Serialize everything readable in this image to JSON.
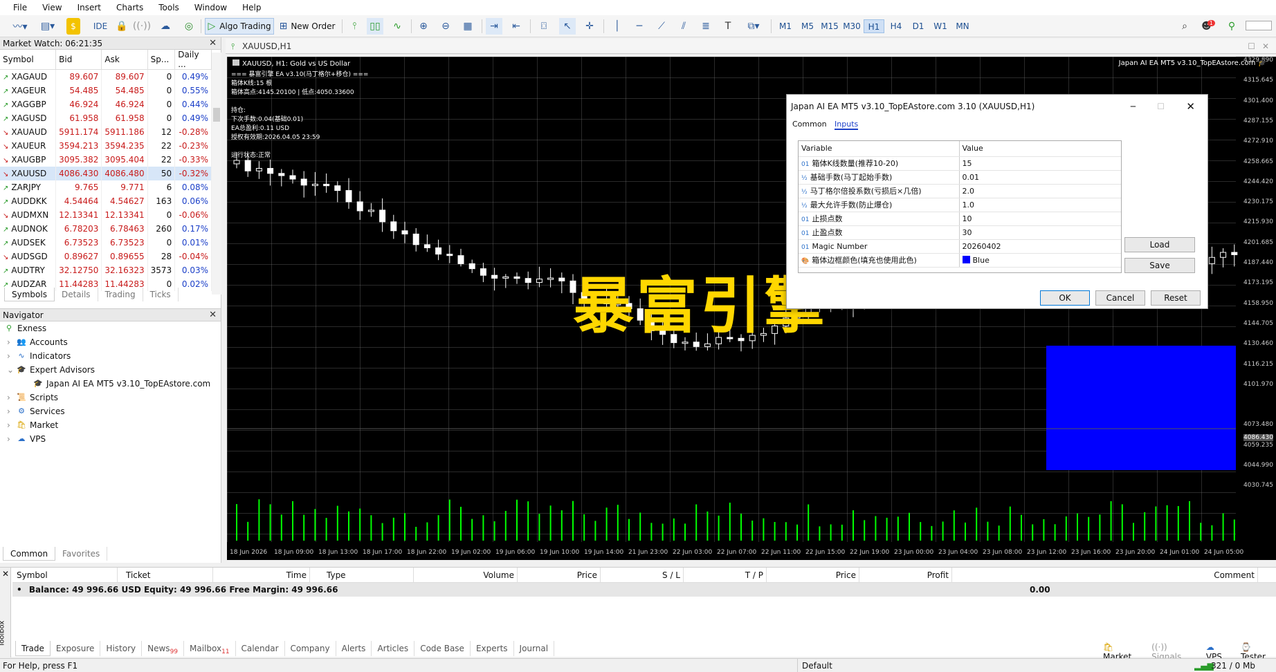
{
  "menu": [
    "File",
    "View",
    "Insert",
    "Charts",
    "Tools",
    "Window",
    "Help"
  ],
  "toolbar": {
    "ide": "IDE",
    "algo_trading": "Algo Trading",
    "new_order": "New Order",
    "timeframes": [
      "M1",
      "M5",
      "M15",
      "M30",
      "H1",
      "H4",
      "D1",
      "W1",
      "MN"
    ],
    "active_tf": "H1"
  },
  "market_watch": {
    "title": "Market Watch: 06:21:35",
    "headers": [
      "Symbol",
      "Bid",
      "Ask",
      "Sp...",
      "Daily ..."
    ],
    "rows": [
      [
        "XAGAUD",
        "89.607",
        "89.607",
        "0",
        "0.49%"
      ],
      [
        "XAGEUR",
        "54.485",
        "54.485",
        "0",
        "0.55%"
      ],
      [
        "XAGGBP",
        "46.924",
        "46.924",
        "0",
        "0.44%"
      ],
      [
        "XAGUSD",
        "61.958",
        "61.958",
        "0",
        "0.49%"
      ],
      [
        "XAUAUD",
        "5911.174",
        "5911.186",
        "12",
        "-0.28%"
      ],
      [
        "XAUEUR",
        "3594.213",
        "3594.235",
        "22",
        "-0.23%"
      ],
      [
        "XAUGBP",
        "3095.382",
        "3095.404",
        "22",
        "-0.33%"
      ],
      [
        "XAUUSD",
        "4086.430",
        "4086.480",
        "50",
        "-0.32%"
      ],
      [
        "ZARJPY",
        "9.765",
        "9.771",
        "6",
        "0.08%"
      ],
      [
        "AUDDKK",
        "4.54464",
        "4.54627",
        "163",
        "0.06%"
      ],
      [
        "AUDMXN",
        "12.13341",
        "12.13341",
        "0",
        "-0.06%"
      ],
      [
        "AUDNOK",
        "6.78203",
        "6.78463",
        "260",
        "0.17%"
      ],
      [
        "AUDSEK",
        "6.73523",
        "6.73523",
        "0",
        "0.01%"
      ],
      [
        "AUDSGD",
        "0.89627",
        "0.89655",
        "28",
        "-0.04%"
      ],
      [
        "AUDTRY",
        "32.12750",
        "32.16323",
        "3573",
        "0.03%"
      ],
      [
        "AUDZAR",
        "11.44283",
        "11.44283",
        "0",
        "0.02%"
      ]
    ],
    "tabs": [
      "Symbols",
      "Details",
      "Trading",
      "Ticks"
    ]
  },
  "navigator": {
    "title": "Navigator",
    "items": [
      "Exness",
      "Accounts",
      "Indicators",
      "Expert Advisors",
      "Japan AI EA MT5 v3.10_TopEAstore.com",
      "Scripts",
      "Services",
      "Market",
      "VPS"
    ],
    "tabs": [
      "Common",
      "Favorites"
    ]
  },
  "chart": {
    "tab": "XAUUSD,H1",
    "header": "XAUUSD, H1:  Gold vs US Dollar",
    "ea_label": "Japan AI EA MT5 v3.10_TopEAstore.com",
    "info_lines": [
      "=== 暴富引擎 EA v3.10(马丁格尔+移仓) ===",
      "箱体K线:15 根",
      "箱体高点:4145.20100  |  低点:4050.33600",
      "持仓:",
      "下次手数:0.04(基础0.01)",
      "EA总盈利:0.11 USD",
      "授权有效期:2026.04.05 23:59",
      "运行状态:正常"
    ],
    "watermark": "暴富引擎",
    "prices": [
      "4329.890",
      "4315.645",
      "4301.400",
      "4287.155",
      "4272.910",
      "4258.665",
      "4244.420",
      "4230.175",
      "4215.930",
      "4201.685",
      "4187.440",
      "4173.195",
      "4158.950",
      "4144.705",
      "4130.460",
      "4116.215",
      "4101.970",
      "4086.430",
      "4073.480",
      "4059.235",
      "4044.990",
      "4030.745"
    ],
    "times": [
      "18 Jun 2026",
      "18 Jun 09:00",
      "18 Jun 13:00",
      "18 Jun 17:00",
      "18 Jun 22:00",
      "19 Jun 02:00",
      "19 Jun 06:00",
      "19 Jun 10:00",
      "19 Jun 14:00",
      "21 Jun 23:00",
      "22 Jun 03:00",
      "22 Jun 07:00",
      "22 Jun 11:00",
      "22 Jun 15:00",
      "22 Jun 19:00",
      "23 Jun 00:00",
      "23 Jun 04:00",
      "23 Jun 08:00",
      "23 Jun 12:00",
      "23 Jun 16:00",
      "23 Jun 20:00",
      "24 Jun 01:00",
      "24 Jun 05:00"
    ]
  },
  "dialog": {
    "title": "Japan AI EA MT5 v3.10_TopEAstore.com 3.10 (XAUUSD,H1)",
    "tabs": [
      "Common",
      "Inputs"
    ],
    "headers": [
      "Variable",
      "Value"
    ],
    "rows": [
      [
        "01",
        "箱体K线数量(推荐10-20)",
        "15"
      ],
      [
        "½",
        "基础手数(马丁起始手数)",
        "0.01"
      ],
      [
        "½",
        "马丁格尔倍投系数(亏损后×几倍)",
        "2.0"
      ],
      [
        "½",
        "最大允许手数(防止爆仓)",
        "1.0"
      ],
      [
        "01",
        "止损点数",
        "10"
      ],
      [
        "01",
        "止盈点数",
        "30"
      ],
      [
        "01",
        "Magic Number",
        "20260402"
      ],
      [
        "🎨",
        "箱体边框颜色(填充也使用此色)",
        "Blue"
      ]
    ],
    "load": "Load",
    "save": "Save",
    "ok": "OK",
    "cancel": "Cancel",
    "reset": "Reset"
  },
  "terminal": {
    "headers": [
      "Symbol",
      "Ticket",
      "Time",
      "Type",
      "Volume",
      "Price",
      "S / L",
      "T / P",
      "Price",
      "Profit",
      "Comment"
    ],
    "balance": "Balance: 49 996.66 USD  Equity: 49 996.66  Free Margin: 49 996.66",
    "profit": "0.00",
    "tabs": [
      "Trade",
      "Exposure",
      "History",
      "News",
      "Mailbox",
      "Calendar",
      "Company",
      "Alerts",
      "Articles",
      "Code Base",
      "Experts",
      "Journal"
    ],
    "news_badge": "99",
    "mail_badge": "11",
    "toolbox": "Toolbox",
    "right": [
      "Market",
      "Signals",
      "VPS",
      "Tester"
    ]
  },
  "status": {
    "help": "For Help, press F1",
    "profile": "Default",
    "mem": "321 / 0 Mb"
  },
  "colors": {
    "bull": "#ffffff",
    "bear": "#ffffff",
    "wick": "#ffffff",
    "volume": "#00ff00",
    "box": "#0000ff",
    "watermark": "#ffd700"
  }
}
